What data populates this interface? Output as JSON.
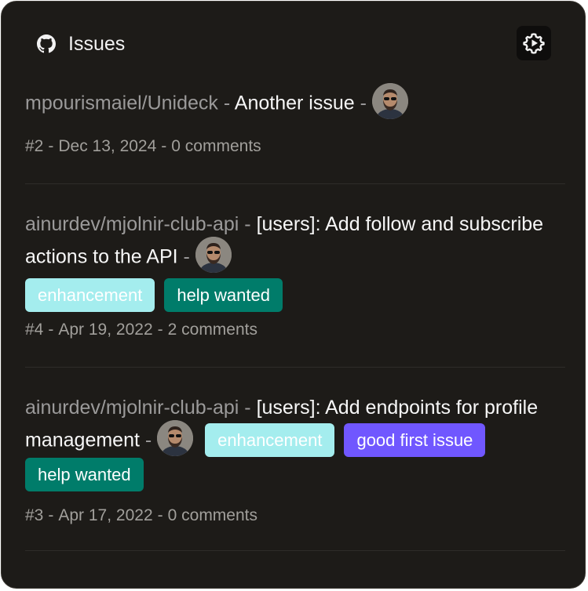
{
  "header": {
    "title": "Issues",
    "icon": "github-icon",
    "settings_icon": "gear-icon"
  },
  "issues": [
    {
      "repo": "mpourismaiel/Unideck",
      "title": "Another issue",
      "labels": [],
      "number": "#2",
      "date": "Dec 13, 2024",
      "comments": "0 comments"
    },
    {
      "repo": "ainurdev/mjolnir-club-api",
      "title": "[users]: Add follow and subscribe actions to the API",
      "labels": [
        {
          "name": "enhancement",
          "color": "#a4edee"
        },
        {
          "name": "help wanted",
          "color": "#007c6a"
        }
      ],
      "number": "#4",
      "date": "Apr 19, 2022",
      "comments": "2 comments"
    },
    {
      "repo": "ainurdev/mjolnir-club-api",
      "title": "[users]: Add endpoints for profile management",
      "labels": [
        {
          "name": "enhancement",
          "color": "#a4edee"
        },
        {
          "name": "good first issue",
          "color": "#7057ff"
        },
        {
          "name": "help wanted",
          "color": "#007c6a"
        }
      ],
      "number": "#3",
      "date": "Apr 17, 2022",
      "comments": "0 comments"
    }
  ],
  "separator": "-",
  "colors": {
    "background": "#1d1b18",
    "muted_text": "#9b9a9a"
  }
}
